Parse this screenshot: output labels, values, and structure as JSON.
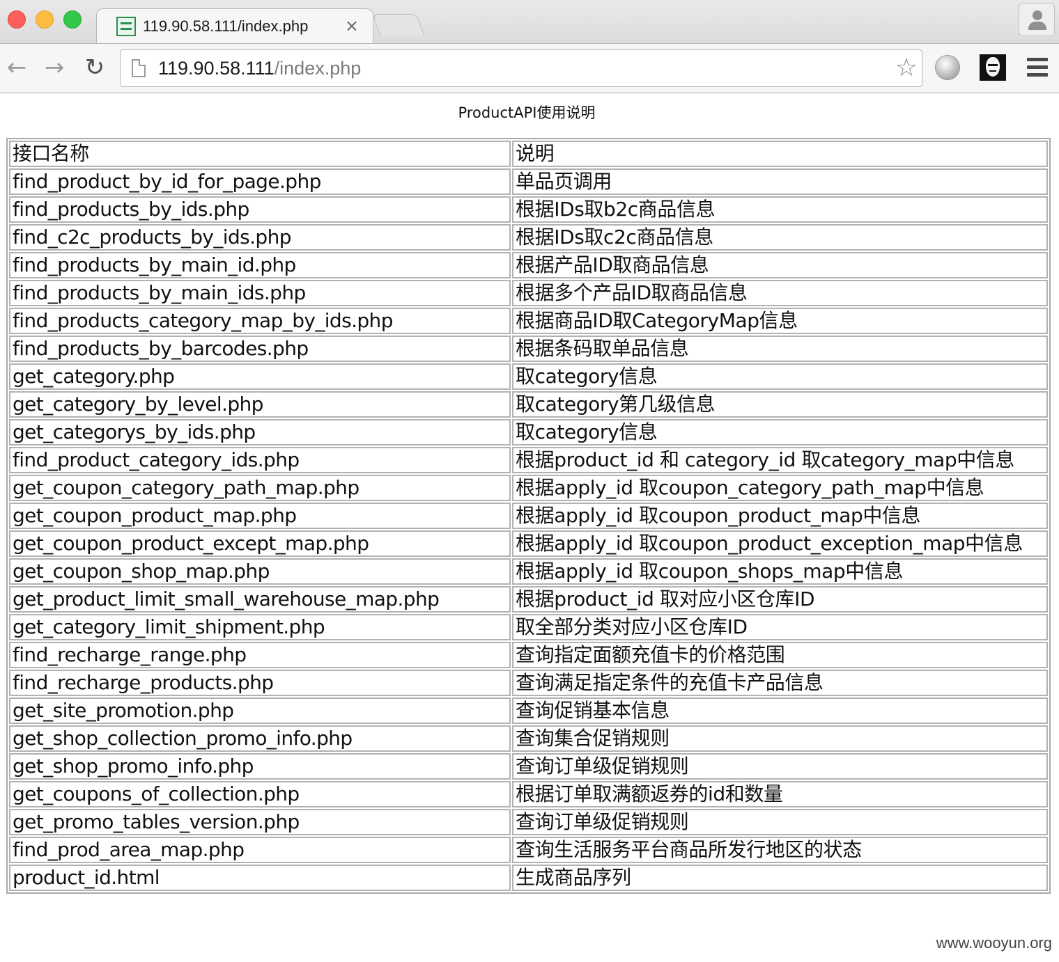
{
  "browser": {
    "tab": {
      "title": "119.90.58.111/index.php",
      "close": "×"
    },
    "address_bar": {
      "host": "119.90.58.111",
      "path": "/index.php"
    },
    "icons": {
      "back": "arrow-left-icon",
      "forward": "arrow-right-icon",
      "reload": "reload-icon",
      "bookmark": "star-icon",
      "menu": "hamburger-menu-icon",
      "profile": "user-icon"
    },
    "colors": {
      "close": "#fc605b",
      "minimize": "#fdbc40",
      "zoom": "#34c84a"
    }
  },
  "page": {
    "heading": "ProductAPI使用说明",
    "table": {
      "headers": [
        "接口名称",
        "说明"
      ],
      "rows": [
        [
          "find_product_by_id_for_page.php",
          "单品页调用"
        ],
        [
          "find_products_by_ids.php",
          "根据IDs取b2c商品信息"
        ],
        [
          "find_c2c_products_by_ids.php",
          "根据IDs取c2c商品信息"
        ],
        [
          "find_products_by_main_id.php",
          "根据产品ID取商品信息"
        ],
        [
          "find_products_by_main_ids.php",
          "根据多个产品ID取商品信息"
        ],
        [
          "find_products_category_map_by_ids.php",
          "根据商品ID取CategoryMap信息"
        ],
        [
          "find_products_by_barcodes.php",
          "根据条码取单品信息"
        ],
        [
          "get_category.php",
          "取category信息"
        ],
        [
          "get_category_by_level.php",
          "取category第几级信息"
        ],
        [
          "get_categorys_by_ids.php",
          "取category信息"
        ],
        [
          "find_product_category_ids.php",
          "根据product_id 和 category_id 取category_map中信息"
        ],
        [
          "get_coupon_category_path_map.php",
          "根据apply_id 取coupon_category_path_map中信息"
        ],
        [
          "get_coupon_product_map.php",
          "根据apply_id 取coupon_product_map中信息"
        ],
        [
          "get_coupon_product_except_map.php",
          "根据apply_id 取coupon_product_exception_map中信息"
        ],
        [
          "get_coupon_shop_map.php",
          "根据apply_id 取coupon_shops_map中信息"
        ],
        [
          "get_product_limit_small_warehouse_map.php",
          "根据product_id 取对应小区仓库ID"
        ],
        [
          "get_category_limit_shipment.php",
          "取全部分类对应小区仓库ID"
        ],
        [
          "find_recharge_range.php",
          "查询指定面额充值卡的价格范围"
        ],
        [
          "find_recharge_products.php",
          "查询满足指定条件的充值卡产品信息"
        ],
        [
          "get_site_promotion.php",
          "查询促销基本信息"
        ],
        [
          "get_shop_collection_promo_info.php",
          "查询集合促销规则"
        ],
        [
          "get_shop_promo_info.php",
          "查询订单级促销规则"
        ],
        [
          "get_coupons_of_collection.php",
          "根据订单取满额返券的id和数量"
        ],
        [
          "get_promo_tables_version.php",
          "查询订单级促销规则"
        ],
        [
          "find_prod_area_map.php",
          "查询生活服务平台商品所发行地区的状态"
        ],
        [
          "product_id.html",
          "生成商品序列"
        ]
      ]
    }
  },
  "watermark": "www.wooyun.org"
}
